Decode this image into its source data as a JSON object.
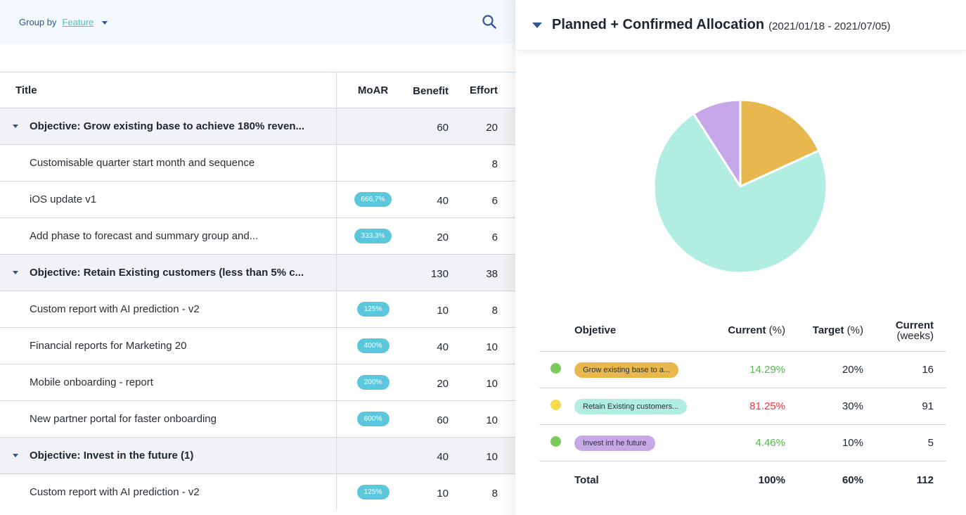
{
  "toolbar": {
    "group_by_label": "Group by",
    "group_by_value": "Feature",
    "search_icon": "search-icon"
  },
  "table": {
    "columns": [
      "Title",
      "MoAR",
      "Benefit",
      "Effort"
    ],
    "rows": [
      {
        "type": "group",
        "title": "Objective: Grow existing base to achieve 180% reven...",
        "moar": "",
        "benefit": "60",
        "effort": "20"
      },
      {
        "type": "item",
        "title": "Customisable quarter start month and sequence",
        "moar": "",
        "benefit": "",
        "effort": "8"
      },
      {
        "type": "item",
        "title": "iOS update v1",
        "moar": "666,7%",
        "benefit": "40",
        "effort": "6"
      },
      {
        "type": "item",
        "title": "Add phase to forecast and summary group and...",
        "moar": "333,3%",
        "benefit": "20",
        "effort": "6"
      },
      {
        "type": "group",
        "title": "Objective: Retain Existing customers (less than 5% c...",
        "moar": "",
        "benefit": "130",
        "effort": "38"
      },
      {
        "type": "item",
        "title": "Custom report with AI prediction - v2",
        "moar": "125%",
        "benefit": "10",
        "effort": "8"
      },
      {
        "type": "item",
        "title": "Financial reports for Marketing 20",
        "moar": "400%",
        "benefit": "40",
        "effort": "10"
      },
      {
        "type": "item",
        "title": "Mobile onboarding - report",
        "moar": "200%",
        "benefit": "20",
        "effort": "10"
      },
      {
        "type": "item",
        "title": "New partner portal for faster onboarding",
        "moar": "600%",
        "benefit": "60",
        "effort": "10"
      },
      {
        "type": "group",
        "title": "Objective: Invest in the future (1)",
        "moar": "",
        "benefit": "40",
        "effort": "10"
      },
      {
        "type": "item",
        "title": "Custom report with AI prediction - v2",
        "moar": "125%",
        "benefit": "10",
        "effort": "8"
      }
    ]
  },
  "panel": {
    "title": "Planned + Confirmed Allocation",
    "date_range": "(2021/01/18 - 2021/07/05)"
  },
  "allocation": {
    "headers": {
      "objective": "Objetive",
      "current": "Current",
      "current_unit": "(%)",
      "target": "Target",
      "target_unit": "(%)",
      "weeks": "Current",
      "weeks_unit": "(weeks)"
    },
    "rows": [
      {
        "status_color": "#7ccc5c",
        "label": "Grow existing base to a...",
        "pill_color": "#e8b84f",
        "current": "14.29%",
        "current_color": "#52b94a",
        "target": "20%",
        "weeks": "16"
      },
      {
        "status_color": "#f6dc4a",
        "label": "Retain Existing customers...",
        "pill_color": "#b2ede1",
        "current": "81.25%",
        "current_color": "#e8383d",
        "target": "30%",
        "weeks": "91"
      },
      {
        "status_color": "#7ccc5c",
        "label": "Invest int he future",
        "pill_color": "#c6a7e8",
        "current": "4.46%",
        "current_color": "#52b94a",
        "target": "10%",
        "weeks": "5"
      }
    ],
    "total": {
      "label": "Total",
      "current": "100%",
      "target": "60%",
      "weeks": "112"
    }
  },
  "chart_data": {
    "type": "pie",
    "title": "Planned + Confirmed Allocation",
    "categories": [
      "Grow existing base to achieve 180% revenue",
      "Retain Existing customers",
      "Invest in the future"
    ],
    "values": [
      18.2,
      72.7,
      9.1
    ],
    "colors": [
      "#e8b84f",
      "#b2ede1",
      "#c6a7e8"
    ],
    "start": "12 o'clock, clockwise",
    "legend": "none"
  }
}
